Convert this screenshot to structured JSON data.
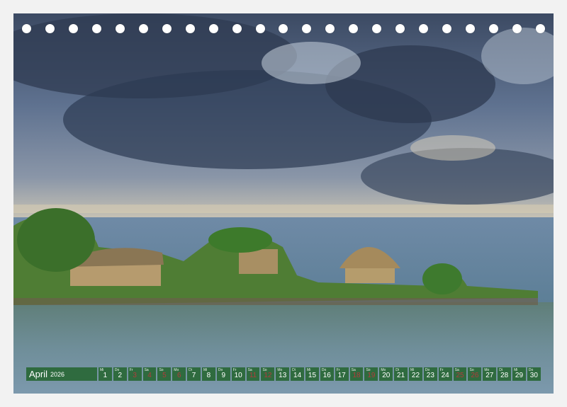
{
  "calendar": {
    "month": "April",
    "year": "2026",
    "days": [
      {
        "n": "1",
        "wd": "Mi",
        "weekend": false
      },
      {
        "n": "2",
        "wd": "Do",
        "weekend": false
      },
      {
        "n": "3",
        "wd": "Fr",
        "weekend": true
      },
      {
        "n": "4",
        "wd": "Sa",
        "weekend": true
      },
      {
        "n": "5",
        "wd": "So",
        "weekend": true
      },
      {
        "n": "6",
        "wd": "Mo",
        "weekend": true
      },
      {
        "n": "7",
        "wd": "Di",
        "weekend": false
      },
      {
        "n": "8",
        "wd": "Mi",
        "weekend": false
      },
      {
        "n": "9",
        "wd": "Do",
        "weekend": false
      },
      {
        "n": "10",
        "wd": "Fr",
        "weekend": false
      },
      {
        "n": "11",
        "wd": "Sa",
        "weekend": true
      },
      {
        "n": "12",
        "wd": "So",
        "weekend": true
      },
      {
        "n": "13",
        "wd": "Mo",
        "weekend": false
      },
      {
        "n": "14",
        "wd": "Di",
        "weekend": false
      },
      {
        "n": "15",
        "wd": "Mi",
        "weekend": false
      },
      {
        "n": "16",
        "wd": "Do",
        "weekend": false
      },
      {
        "n": "17",
        "wd": "Fr",
        "weekend": false
      },
      {
        "n": "18",
        "wd": "Sa",
        "weekend": true
      },
      {
        "n": "19",
        "wd": "So",
        "weekend": true
      },
      {
        "n": "20",
        "wd": "Mo",
        "weekend": false
      },
      {
        "n": "21",
        "wd": "Di",
        "weekend": false
      },
      {
        "n": "22",
        "wd": "Mi",
        "weekend": false
      },
      {
        "n": "23",
        "wd": "Do",
        "weekend": false
      },
      {
        "n": "24",
        "wd": "Fr",
        "weekend": false
      },
      {
        "n": "25",
        "wd": "Sa",
        "weekend": true
      },
      {
        "n": "26",
        "wd": "So",
        "weekend": true
      },
      {
        "n": "27",
        "wd": "Mo",
        "weekend": false
      },
      {
        "n": "28",
        "wd": "Di",
        "weekend": false
      },
      {
        "n": "29",
        "wd": "Mi",
        "weekend": false
      },
      {
        "n": "30",
        "wd": "Do",
        "weekend": false
      }
    ]
  },
  "binding": {
    "ring_count": 23
  },
  "colors": {
    "bar": "#2f6b3f",
    "weekend_text": "#b13b3b",
    "text": "#ffffff"
  }
}
